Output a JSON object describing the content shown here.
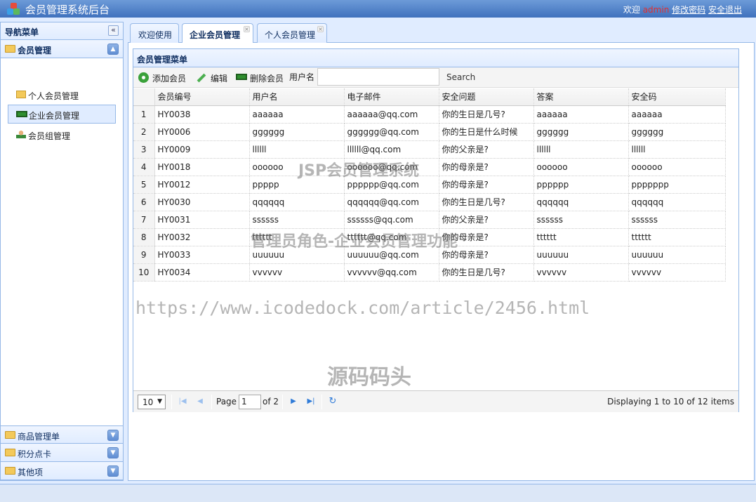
{
  "header": {
    "title": "会员管理系统后台",
    "welcome": "欢迎",
    "user": "admin",
    "change_password": "修改密码",
    "logout": "安全退出"
  },
  "nav": {
    "title": "导航菜单",
    "collapse_glyph": "«",
    "section_member": "会员管理",
    "items": [
      {
        "label": "个人会员管理",
        "icon": "folder-icon"
      },
      {
        "label": "企业会员管理",
        "icon": "company-icon"
      },
      {
        "label": "会员组管理",
        "icon": "user-group-icon"
      }
    ],
    "sections_bottom": [
      "商品管理单",
      "积分点卡",
      "其他项"
    ]
  },
  "tabs": [
    {
      "label": "欢迎使用",
      "closable": false
    },
    {
      "label": "企业会员管理",
      "closable": true,
      "active": true
    },
    {
      "label": "个人会员管理",
      "closable": true
    }
  ],
  "grid": {
    "title": "会员管理菜单",
    "toolbar": {
      "add": "添加会员",
      "edit": "编辑",
      "delete": "删除会员",
      "search_label": "用户名",
      "search_placeholder": "",
      "search_button": "Search"
    },
    "columns": [
      "会员编号",
      "用户名",
      "电子邮件",
      "安全问题",
      "答案",
      "安全码"
    ],
    "rows": [
      [
        "1",
        "HY0038",
        "aaaaaa",
        "aaaaaa@qq.com",
        "你的生日是几号?",
        "aaaaaa",
        "aaaaaa"
      ],
      [
        "2",
        "HY0006",
        "gggggg",
        "gggggg@qq.com",
        "你的生日是什么时候",
        "gggggg",
        "gggggg"
      ],
      [
        "3",
        "HY0009",
        "llllll",
        "llllll@qq.com",
        "你的父亲是?",
        "llllll",
        "llllll"
      ],
      [
        "4",
        "HY0018",
        "oooooo",
        "oooooo@qq.com",
        "你的母亲是?",
        "oooooo",
        "oooooo"
      ],
      [
        "5",
        "HY0012",
        "ppppp",
        "pppppp@qq.com",
        "你的母亲是?",
        "pppppp",
        "ppppppp"
      ],
      [
        "6",
        "HY0030",
        "qqqqqq",
        "qqqqqq@qq.com",
        "你的生日是几号?",
        "qqqqqq",
        "qqqqqq"
      ],
      [
        "7",
        "HY0031",
        "ssssss",
        "ssssss@qq.com",
        "你的父亲是?",
        "ssssss",
        "ssssss"
      ],
      [
        "8",
        "HY0032",
        "tttttt",
        "tttttt@qq.com",
        "你的母亲是?",
        "tttttt",
        "tttttt"
      ],
      [
        "9",
        "HY0033",
        "uuuuuu",
        "uuuuuu@qq.com",
        "你的母亲是?",
        "uuuuuu",
        "uuuuuu"
      ],
      [
        "10",
        "HY0034",
        "vvvvvv",
        "vvvvvv@qq.com",
        "你的生日是几号?",
        "vvvvvv",
        "vvvvvv"
      ]
    ],
    "pager": {
      "page_size": "10",
      "page_label": "Page",
      "page_value": "1",
      "of_label": "of 2",
      "info": "Displaying 1 to 10 of 12 items"
    }
  },
  "watermarks": {
    "line1": "JSP会员管理系统",
    "line2": "管理员角色-企业会员管理功能",
    "url": "https://www.icodedock.com/article/2456.html",
    "brand": "源码码头"
  },
  "colors": {
    "header_bg": "#3f71bd",
    "panel_border": "#95b8e7",
    "panel_header": "#e0ecff",
    "admin_text": "#e03030"
  }
}
